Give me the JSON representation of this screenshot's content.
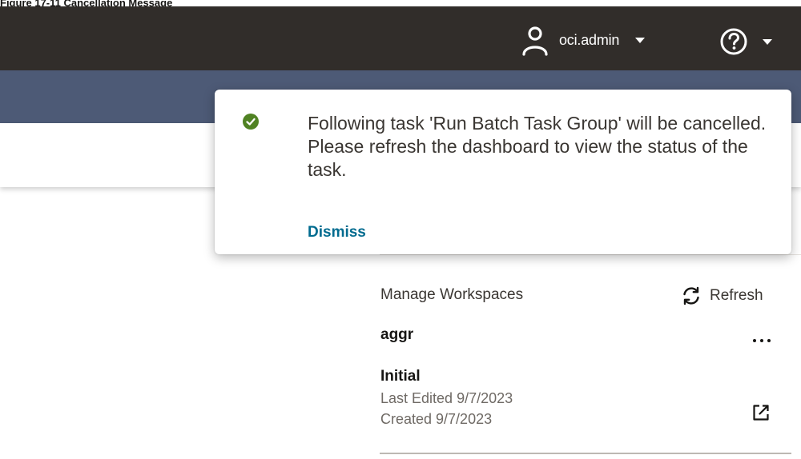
{
  "caption": "Figure 17-11 Cancellation Message",
  "header": {
    "user": {
      "name": "oci.admin",
      "icon": "user-icon"
    },
    "help": {
      "icon": "help-icon"
    }
  },
  "toast": {
    "status": "success",
    "icon": "check-circle-icon",
    "message": "Following task 'Run Batch Task Group' will be cancelled. Please refresh the dashboard to view the status of the task.",
    "dismiss_label": "Dismiss"
  },
  "workspaces": {
    "title": "Manage Workspaces",
    "refresh_label": "Refresh",
    "workspace": {
      "name": "aggr",
      "version": "Initial",
      "last_edited": "Last Edited 9/7/2023",
      "created": "Created 9/7/2023"
    }
  },
  "colors": {
    "header_bg": "#312d2a",
    "subheader_bg": "#4d5a76",
    "success": "#508223",
    "link": "#006b8f"
  }
}
